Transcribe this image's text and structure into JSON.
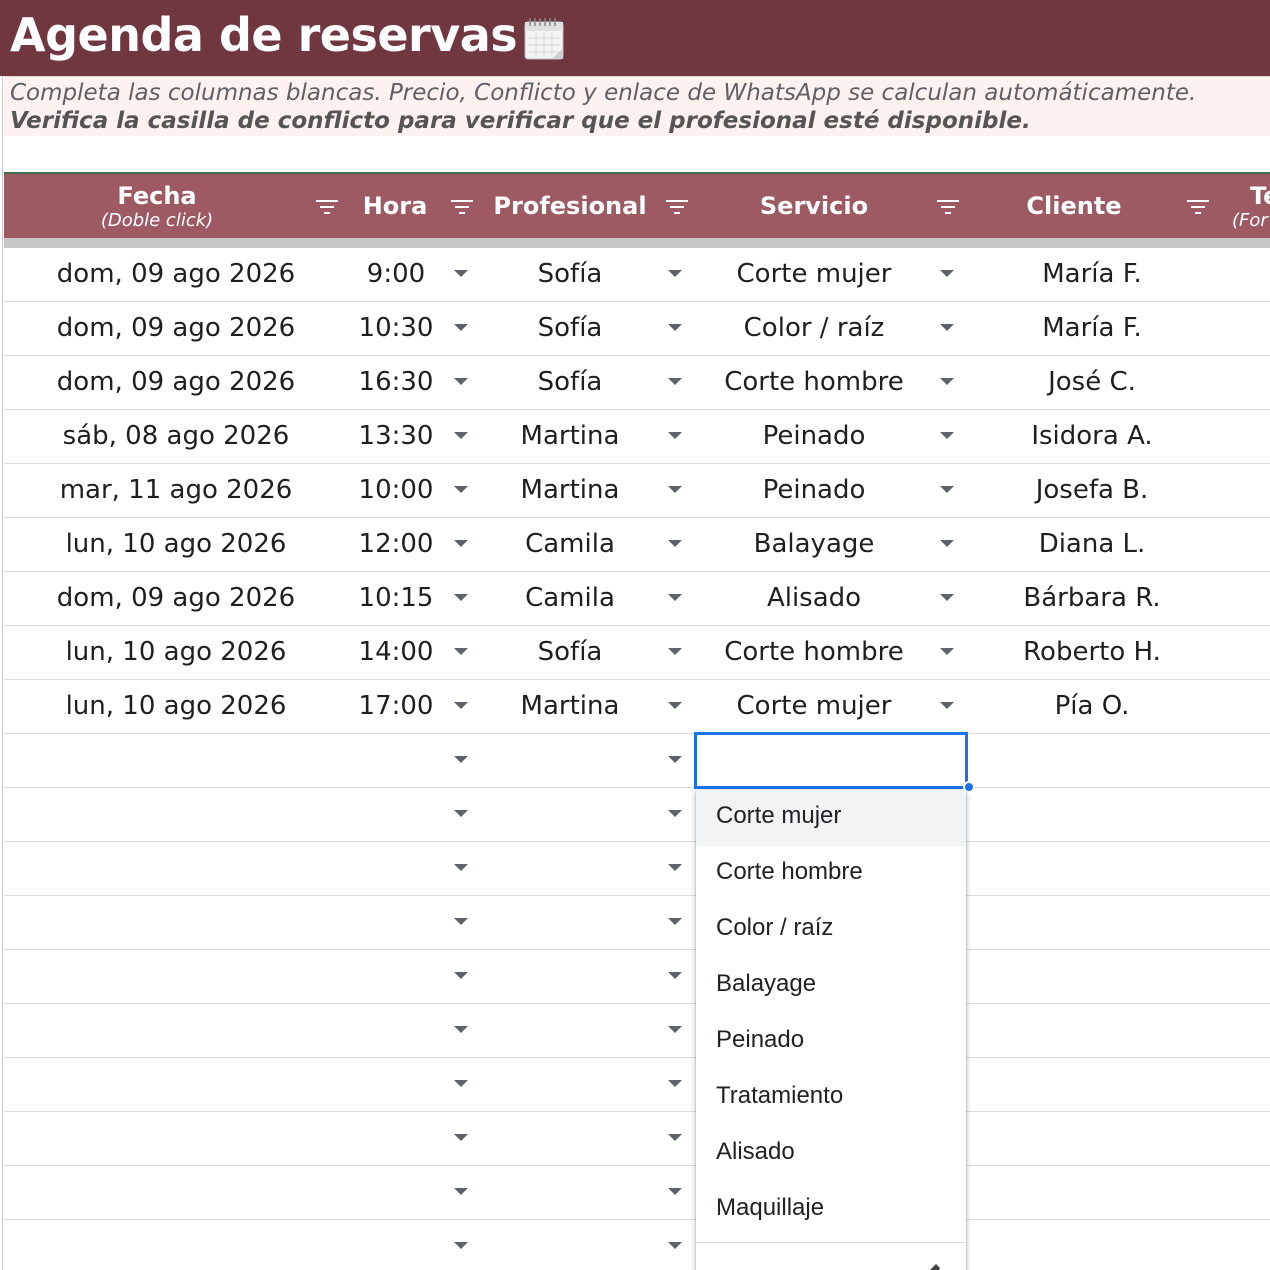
{
  "title": "Agenda de reservas",
  "instructions": {
    "line1": "Completa las columnas blancas. Precio, Conflicto y enlace de WhatsApp se calculan automáticamente.",
    "line2": "Verifica la casilla de conflicto para verificar que el profesional esté disponible."
  },
  "columns": {
    "fecha": "Fecha",
    "fecha_sub": "(Doble click)",
    "hora": "Hora",
    "profesional": "Profesional",
    "servicio": "Servicio",
    "cliente": "Cliente",
    "next": "Te",
    "next_sub": "(For"
  },
  "rows": [
    {
      "fecha": "dom, 09 ago 2026",
      "hora": "9:00",
      "profesional": "Sofía",
      "servicio": "Corte mujer",
      "cliente": "María F."
    },
    {
      "fecha": "dom, 09 ago 2026",
      "hora": "10:30",
      "profesional": "Sofía",
      "servicio": "Color / raíz",
      "cliente": "María F."
    },
    {
      "fecha": "dom, 09 ago 2026",
      "hora": "16:30",
      "profesional": "Sofía",
      "servicio": "Corte hombre",
      "cliente": "José C."
    },
    {
      "fecha": "sáb, 08 ago 2026",
      "hora": "13:30",
      "profesional": "Martina",
      "servicio": "Peinado",
      "cliente": "Isidora A."
    },
    {
      "fecha": "mar, 11 ago 2026",
      "hora": "10:00",
      "profesional": "Martina",
      "servicio": "Peinado",
      "cliente": "Josefa B."
    },
    {
      "fecha": "lun, 10 ago 2026",
      "hora": "12:00",
      "profesional": "Camila",
      "servicio": "Balayage",
      "cliente": "Diana L."
    },
    {
      "fecha": "dom, 09 ago 2026",
      "hora": "10:15",
      "profesional": "Camila",
      "servicio": "Alisado",
      "cliente": "Bárbara R."
    },
    {
      "fecha": "lun, 10 ago 2026",
      "hora": "14:00",
      "profesional": "Sofía",
      "servicio": "Corte hombre",
      "cliente": "Roberto H."
    },
    {
      "fecha": "lun, 10 ago 2026",
      "hora": "17:00",
      "profesional": "Martina",
      "servicio": "Corte mujer",
      "cliente": "Pía O."
    },
    {
      "fecha": "",
      "hora": "",
      "profesional": "",
      "servicio": "",
      "cliente": ""
    },
    {
      "fecha": "",
      "hora": "",
      "profesional": "",
      "servicio": "",
      "cliente": ""
    },
    {
      "fecha": "",
      "hora": "",
      "profesional": "",
      "servicio": "",
      "cliente": ""
    },
    {
      "fecha": "",
      "hora": "",
      "profesional": "",
      "servicio": "",
      "cliente": ""
    },
    {
      "fecha": "",
      "hora": "",
      "profesional": "",
      "servicio": "",
      "cliente": ""
    },
    {
      "fecha": "",
      "hora": "",
      "profesional": "",
      "servicio": "",
      "cliente": ""
    },
    {
      "fecha": "",
      "hora": "",
      "profesional": "",
      "servicio": "",
      "cliente": ""
    },
    {
      "fecha": "",
      "hora": "",
      "profesional": "",
      "servicio": "",
      "cliente": ""
    },
    {
      "fecha": "",
      "hora": "",
      "profesional": "",
      "servicio": "",
      "cliente": ""
    },
    {
      "fecha": "",
      "hora": "",
      "profesional": "",
      "servicio": "",
      "cliente": ""
    }
  ],
  "servicio_dropdown": {
    "options": [
      "Corte mujer",
      "Corte hombre",
      "Color / raíz",
      "Balayage",
      "Peinado",
      "Tratamiento",
      "Alisado",
      "Maquillaje"
    ],
    "highlighted": "Corte mujer"
  },
  "colors": {
    "title_bar": "#713741",
    "header_bar": "#9e5a63",
    "instructions_bg": "#fdf2ef",
    "selection": "#1a73e8"
  }
}
